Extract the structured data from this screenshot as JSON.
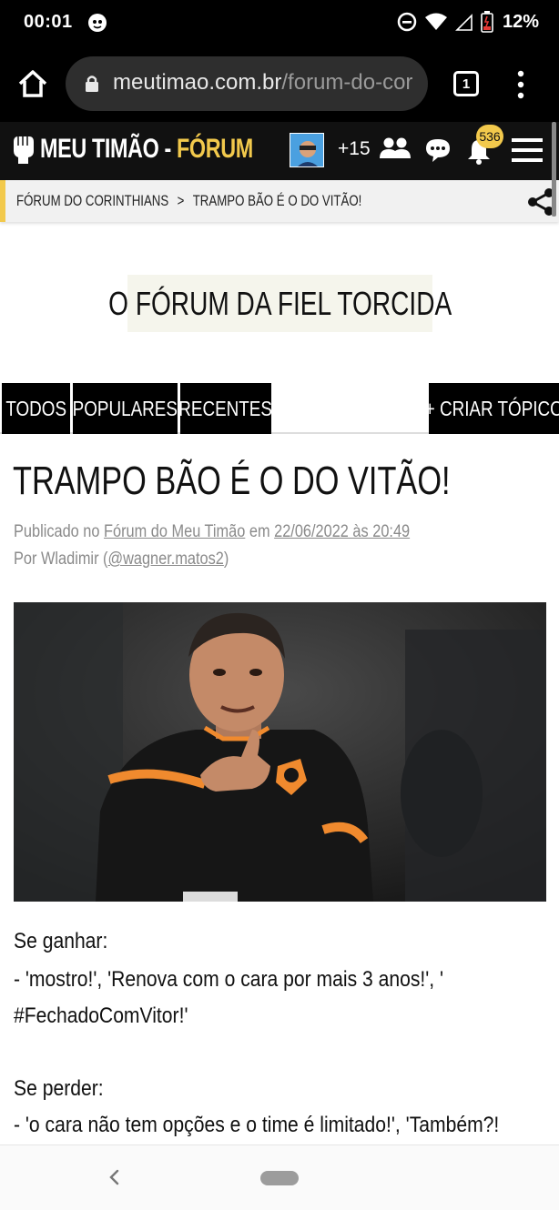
{
  "status_bar": {
    "time": "00:01",
    "battery": "12%",
    "icons": [
      "notification-icon",
      "do-not-disturb-icon",
      "wifi-icon",
      "signal-icon",
      "battery-icon"
    ]
  },
  "browser": {
    "url_domain": "meutimao.com.br",
    "url_path": "/forum-do-cor",
    "tab_count": "1"
  },
  "site": {
    "logo_main": "MEU TIMÃO - ",
    "logo_forum": "FÓRUM",
    "online_count": "+15",
    "notifications_badge": "536"
  },
  "breadcrumb": {
    "items": [
      "FÓRUM DO CORINTHIANS",
      "TRAMPO BÃO É O DO VITÃO!"
    ],
    "separator": ">"
  },
  "hero": {
    "title": "O FÓRUM DA FIEL TORCIDA"
  },
  "tabs": {
    "todos": "TODOS",
    "populares": "POPULARES",
    "recentes": "RECENTES",
    "criar": "+ CRIAR TÓPICO"
  },
  "article": {
    "title": "TRAMPO BÃO É O DO VITÃO!",
    "published_prefix": "Publicado no ",
    "forum_link": "Fórum do Meu Timão",
    "date_prefix": " em ",
    "date": "22/06/2022 às 20:49",
    "author_prefix": "Por Wladimir (",
    "author_handle": "@wagner.matos2",
    "author_suffix": ")",
    "body_lines": [
      "Se ganhar:",
      "- 'mostro!', 'Renova com o cara por mais 3 anos!', '",
      "#FechadoComVitor!'",
      "Se perder:",
      "- 'o cara não tem opções e o time é limitado!', 'Também?!"
    ]
  },
  "colors": {
    "brand_yellow": "#f2c94c",
    "header_black": "#111111",
    "hero_bg": "#f5f5ec",
    "meta_gray": "#8a8a8a"
  }
}
